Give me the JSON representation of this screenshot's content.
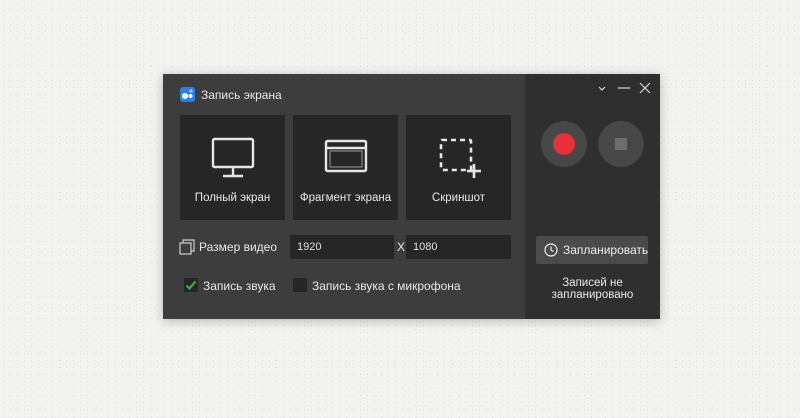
{
  "window": {
    "title": "Запись экрана",
    "app_icon": "app-logo-icon"
  },
  "modes": [
    {
      "label": "Полный экран",
      "icon": "monitor-icon"
    },
    {
      "label": "Фрагмент экрана",
      "icon": "window-icon"
    },
    {
      "label": "Скриншот",
      "icon": "screenshot-region-icon"
    }
  ],
  "video_size": {
    "label": "Размер видео",
    "width": "1920",
    "separator": "X",
    "height": "1080"
  },
  "audio": {
    "system_label": "Запись звука",
    "system_checked": true,
    "mic_label": "Запись звука с микрофона",
    "mic_checked": false
  },
  "side": {
    "schedule_label": "Запланировать",
    "schedule_status": "Записей не запланировано"
  },
  "colors": {
    "record": "#e8303a",
    "check": "#3fae49",
    "app_icon": "#2e7de0"
  }
}
